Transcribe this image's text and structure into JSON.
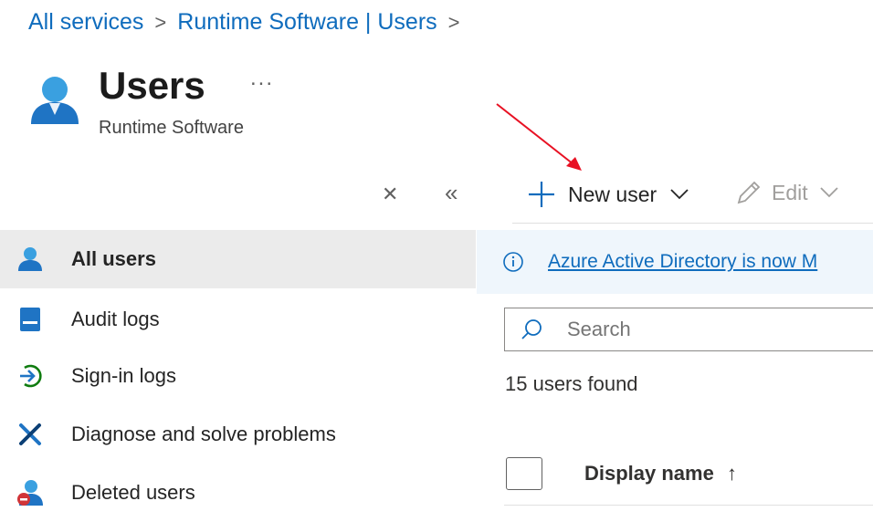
{
  "breadcrumb": {
    "items": [
      "All services",
      "Runtime Software | Users"
    ],
    "separator": ">"
  },
  "header": {
    "icon": "user-icon",
    "title": "Users",
    "more": "...",
    "subtitle": "Runtime Software"
  },
  "sidebar_controls": {
    "close_icon": "close-icon",
    "collapse_icon": "double-chevron-left-icon"
  },
  "toolbar": {
    "new_user_label": "New user",
    "edit_label": "Edit"
  },
  "sidebar": {
    "items": [
      {
        "label": "All users",
        "icon": "user-icon",
        "selected": true
      },
      {
        "label": "Audit logs",
        "icon": "audit-log-icon",
        "selected": false
      },
      {
        "label": "Sign-in logs",
        "icon": "sign-in-icon",
        "selected": false
      },
      {
        "label": "Diagnose and solve problems",
        "icon": "wrench-icon",
        "selected": false
      },
      {
        "label": "Deleted users",
        "icon": "deleted-user-icon",
        "selected": false
      }
    ]
  },
  "banner": {
    "icon": "info-icon",
    "text": "Azure Active Directory is now M"
  },
  "search": {
    "placeholder": "Search"
  },
  "results": {
    "count_text": "15 users found"
  },
  "table": {
    "columns": [
      {
        "label": "Display name",
        "sort_indicator": "↑"
      }
    ]
  },
  "colors": {
    "accent": "#0f6cbd",
    "annotation_arrow": "#e81123",
    "selected_row": "#ebebeb",
    "banner_bg": "#eff6fc"
  }
}
